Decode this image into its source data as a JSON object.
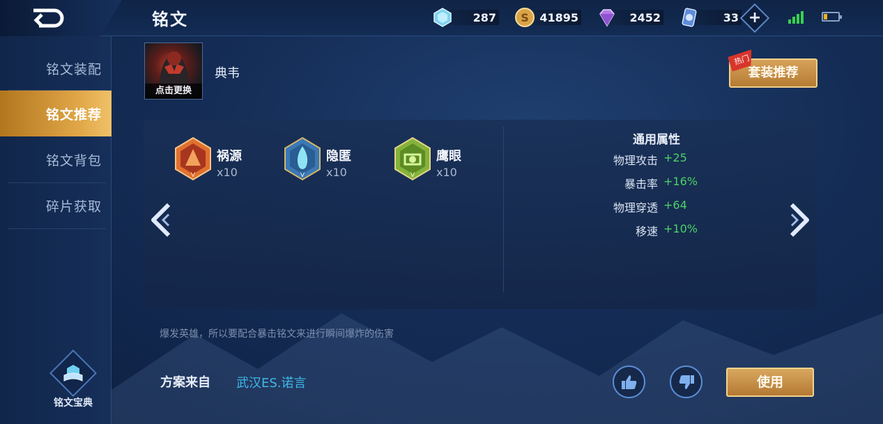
{
  "header": {
    "title": "铭文",
    "resources": [
      {
        "icon": "crystal-icon",
        "value": "287"
      },
      {
        "icon": "gold-coin-icon",
        "value": "41895"
      },
      {
        "icon": "diamond-icon",
        "value": "2452"
      },
      {
        "icon": "voucher-icon",
        "value": "33"
      }
    ]
  },
  "sidebar": {
    "items": [
      {
        "label": "铭文装配",
        "active": false
      },
      {
        "label": "铭文推荐",
        "active": true
      },
      {
        "label": "铭文背包",
        "active": false
      },
      {
        "label": "碎片获取",
        "active": false
      }
    ],
    "codex_label": "铭文宝典"
  },
  "hero": {
    "change_label": "点击更换",
    "name": "典韦"
  },
  "suit_button": {
    "label": "套装推荐",
    "tag": "热门"
  },
  "runes": [
    {
      "name": "祸源",
      "count": "x10",
      "color": "#c0532b"
    },
    {
      "name": "隐匿",
      "count": "x10",
      "color": "#3f8fc4"
    },
    {
      "name": "鹰眼",
      "count": "x10",
      "color": "#7fae34"
    }
  ],
  "attributes": {
    "title": "通用属性",
    "rows": [
      {
        "key": "物理攻击",
        "value": "+25"
      },
      {
        "key": "暴击率",
        "value": "+16%"
      },
      {
        "key": "物理穿透",
        "value": "+64"
      },
      {
        "key": "移速",
        "value": "+10%"
      }
    ]
  },
  "description": "爆发英雄，所以要配合暴击铭文来进行瞬间爆炸的伤害",
  "source": {
    "label": "方案来自",
    "author": "武汉ES.诺言"
  },
  "use_button": {
    "label": "使用"
  },
  "colors": {
    "accent_gold": "#d6a25a",
    "bonus_green": "#4cd264",
    "link_blue": "#3fb8e8"
  }
}
